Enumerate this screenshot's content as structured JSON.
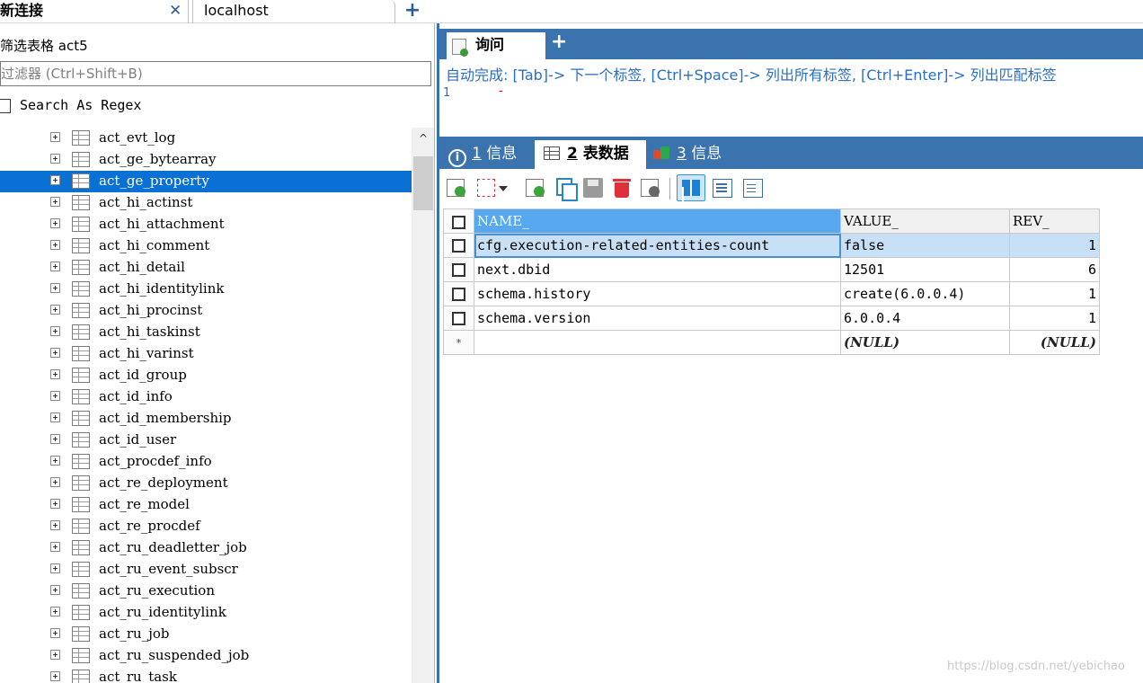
{
  "connection_tabs": {
    "active_label": "新连接",
    "close_glyph": "✕",
    "second_label": "localhost",
    "add_glyph": "+"
  },
  "sidebar": {
    "filter_label": "筛选表格 act5",
    "filter_placeholder": "过滤器 (Ctrl+Shift+B)",
    "regex_label": "Search As Regex",
    "selected_index": 2,
    "tables": [
      "act_evt_log",
      "act_ge_bytearray",
      "act_ge_property",
      "act_hi_actinst",
      "act_hi_attachment",
      "act_hi_comment",
      "act_hi_detail",
      "act_hi_identitylink",
      "act_hi_procinst",
      "act_hi_taskinst",
      "act_hi_varinst",
      "act_id_group",
      "act_id_info",
      "act_id_membership",
      "act_id_user",
      "act_procdef_info",
      "act_re_deployment",
      "act_re_model",
      "act_re_procdef",
      "act_ru_deadletter_job",
      "act_ru_event_subscr",
      "act_ru_execution",
      "act_ru_identitylink",
      "act_ru_job",
      "act_ru_suspended_job",
      "act_ru_task"
    ],
    "scroll_up_glyph": "^"
  },
  "query": {
    "tab_label": "询问",
    "add_glyph": "+",
    "autocomplete_hint": "自动完成: [Tab]-> 下一个标签, [Ctrl+Space]-> 列出所有标签, [Ctrl+Enter]-> 列出匹配标签",
    "editor_line_number": "1",
    "editor_marker": "-"
  },
  "result_tabs": {
    "tab1_num": "1",
    "tab1_label": "信息",
    "tab1_icon": "i",
    "tab2_num": "2",
    "tab2_label": "表数据",
    "tab3_num": "3",
    "tab3_label": "信息"
  },
  "toolbar": {
    "icons": [
      "add-row-icon",
      "filter-dropdown-icon",
      "insert-row-icon",
      "copy-row-icon",
      "save-icon",
      "delete-icon",
      "cancel-icon",
      "grid-view-icon",
      "form-view-icon",
      "text-view-icon"
    ]
  },
  "table": {
    "columns": [
      "NAME_",
      "VALUE_",
      "REV_"
    ],
    "rows": [
      [
        "cfg.execution-related-entities-count",
        "false",
        "1"
      ],
      [
        "next.dbid",
        "12501",
        "6"
      ],
      [
        "schema.history",
        "create(6.0.0.4)",
        "1"
      ],
      [
        "schema.version",
        "6.0.0.4",
        "1"
      ]
    ],
    "new_row_marker": "*",
    "null_text": "(NULL)"
  },
  "watermark": "https://blog.csdn.net/yebichao",
  "colors": {
    "accent_blue": "#3a73ae",
    "selection_blue": "#0a70d4",
    "header_selected": "#57a8ee"
  }
}
